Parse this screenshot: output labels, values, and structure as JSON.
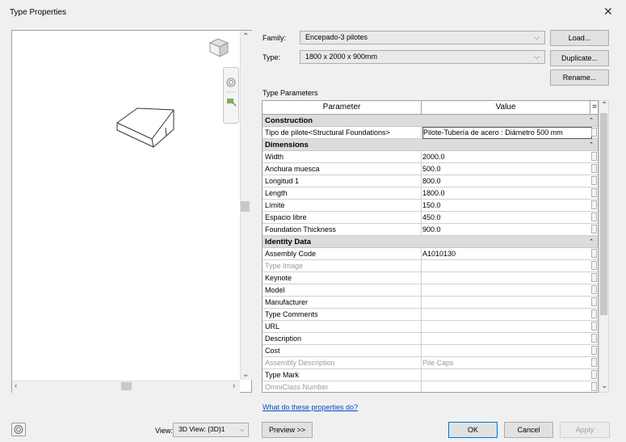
{
  "window": {
    "title": "Type Properties"
  },
  "family": {
    "label": "Family:",
    "value": "Encepado-3 pilotes"
  },
  "type": {
    "label": "Type:",
    "value": "1800 x 2000 x 900mm"
  },
  "buttons": {
    "load": "Load...",
    "duplicate": "Duplicate...",
    "rename": "Rename...",
    "preview": "Preview >>",
    "ok": "OK",
    "cancel": "Cancel",
    "apply": "Apply"
  },
  "section_label": "Type Parameters",
  "table": {
    "headers": {
      "parameter": "Parameter",
      "value": "Value",
      "sort": "="
    },
    "groups": [
      {
        "name": "Construction",
        "rows": [
          {
            "p": "Tipo de pilote<Structural Foundations>",
            "v": "Pilote-Tubería de acero : Diámetro 500 mm"
          }
        ]
      },
      {
        "name": "Dimensions",
        "rows": [
          {
            "p": "Width",
            "v": "2000.0"
          },
          {
            "p": "Anchura muesca",
            "v": "500.0"
          },
          {
            "p": "Longitud 1",
            "v": "800.0"
          },
          {
            "p": "Length",
            "v": "1800.0"
          },
          {
            "p": "Límite",
            "v": "150.0"
          },
          {
            "p": "Espacio libre",
            "v": "450.0"
          },
          {
            "p": "Foundation Thickness",
            "v": "900.0"
          }
        ]
      },
      {
        "name": "Identity Data",
        "rows": [
          {
            "p": "Assembly Code",
            "v": "A1010130"
          },
          {
            "p": "Type Image",
            "v": ""
          },
          {
            "p": "Keynote",
            "v": ""
          },
          {
            "p": "Model",
            "v": ""
          },
          {
            "p": "Manufacturer",
            "v": ""
          },
          {
            "p": "Type Comments",
            "v": ""
          },
          {
            "p": "URL",
            "v": ""
          },
          {
            "p": "Description",
            "v": ""
          },
          {
            "p": "Cost",
            "v": ""
          },
          {
            "p": "Assembly Description",
            "v": "Pile Caps"
          },
          {
            "p": "Type Mark",
            "v": ""
          },
          {
            "p": "OmniClass Number",
            "v": ""
          }
        ]
      }
    ]
  },
  "help_link": "What do these properties do?",
  "view": {
    "label": "View:",
    "value": "3D View: {3D}1"
  },
  "icons": {
    "close": "close-icon",
    "viewcube": "viewcube-icon",
    "nav_wheel": "steering-wheel-icon",
    "zoom": "zoom-icon",
    "model_preview": "foundation-model"
  }
}
